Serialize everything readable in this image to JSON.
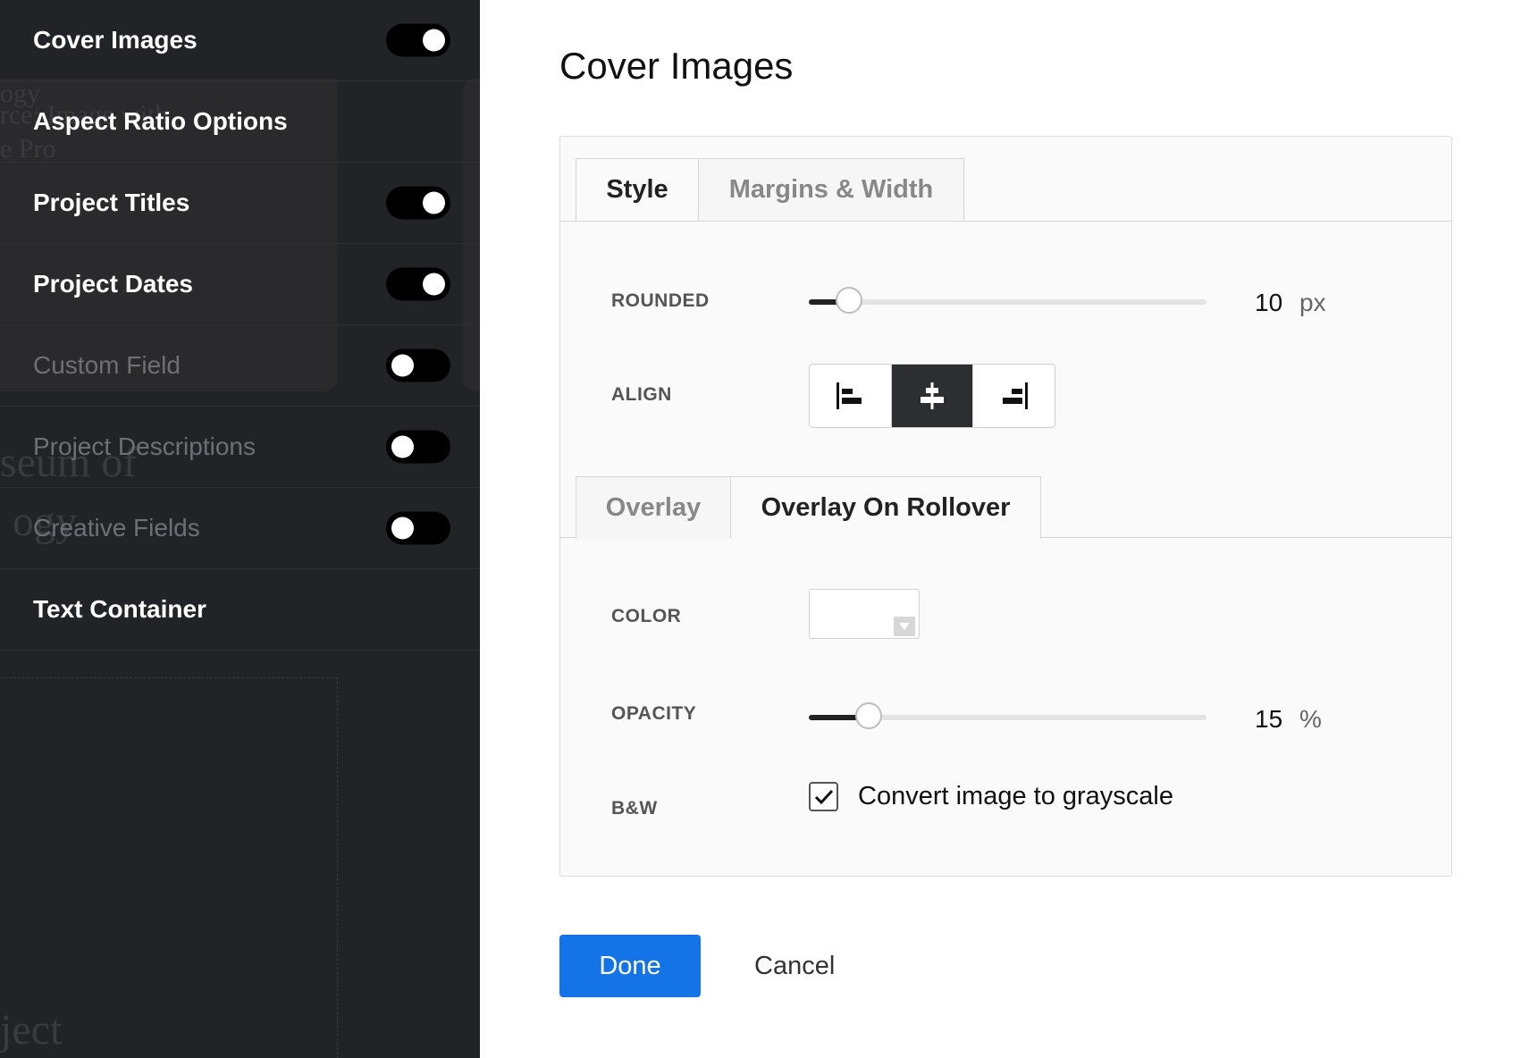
{
  "panel": {
    "rows": [
      {
        "label": "Cover Images",
        "toggle": "on"
      },
      {
        "label": "Aspect Ratio Options",
        "toggle": "none"
      },
      {
        "label": "Project Titles",
        "toggle": "on"
      },
      {
        "label": "Project Dates",
        "toggle": "on"
      },
      {
        "label": "Custom Field",
        "toggle": "off"
      },
      {
        "label": "Project Descriptions",
        "toggle": "off"
      },
      {
        "label": "Creative Fields",
        "toggle": "off"
      },
      {
        "label": "Text Container",
        "toggle": "none"
      }
    ]
  },
  "background": {
    "fragments": [
      "ogy",
      "rce: Image with",
      "e Pro",
      "seum of",
      "ogy",
      "ject"
    ]
  },
  "dialog": {
    "title": "Cover Images",
    "tabs_top": [
      {
        "label": "Style",
        "active": true
      },
      {
        "label": "Margins & Width",
        "active": false
      }
    ],
    "rounded": {
      "label": "ROUNDED",
      "value": "10",
      "unit": "px",
      "max": 100
    },
    "align": {
      "label": "ALIGN",
      "options": [
        "align-left",
        "align-center",
        "align-right"
      ],
      "selected": "align-center"
    },
    "tabs_overlay": [
      {
        "label": "Overlay",
        "active": false
      },
      {
        "label": "Overlay On Rollover",
        "active": true
      }
    ],
    "color": {
      "label": "COLOR",
      "value": "#ffffff"
    },
    "opacity": {
      "label": "OPACITY",
      "value": "15",
      "unit": "%",
      "max": 100
    },
    "bw": {
      "label": "B&W",
      "checkbox_label": "Convert image to grayscale",
      "checked": true
    },
    "done_label": "Done",
    "cancel_label": "Cancel"
  },
  "colors": {
    "panel_bg": "#222327",
    "accent": "#1473e6",
    "toggle_track": "#000000"
  }
}
